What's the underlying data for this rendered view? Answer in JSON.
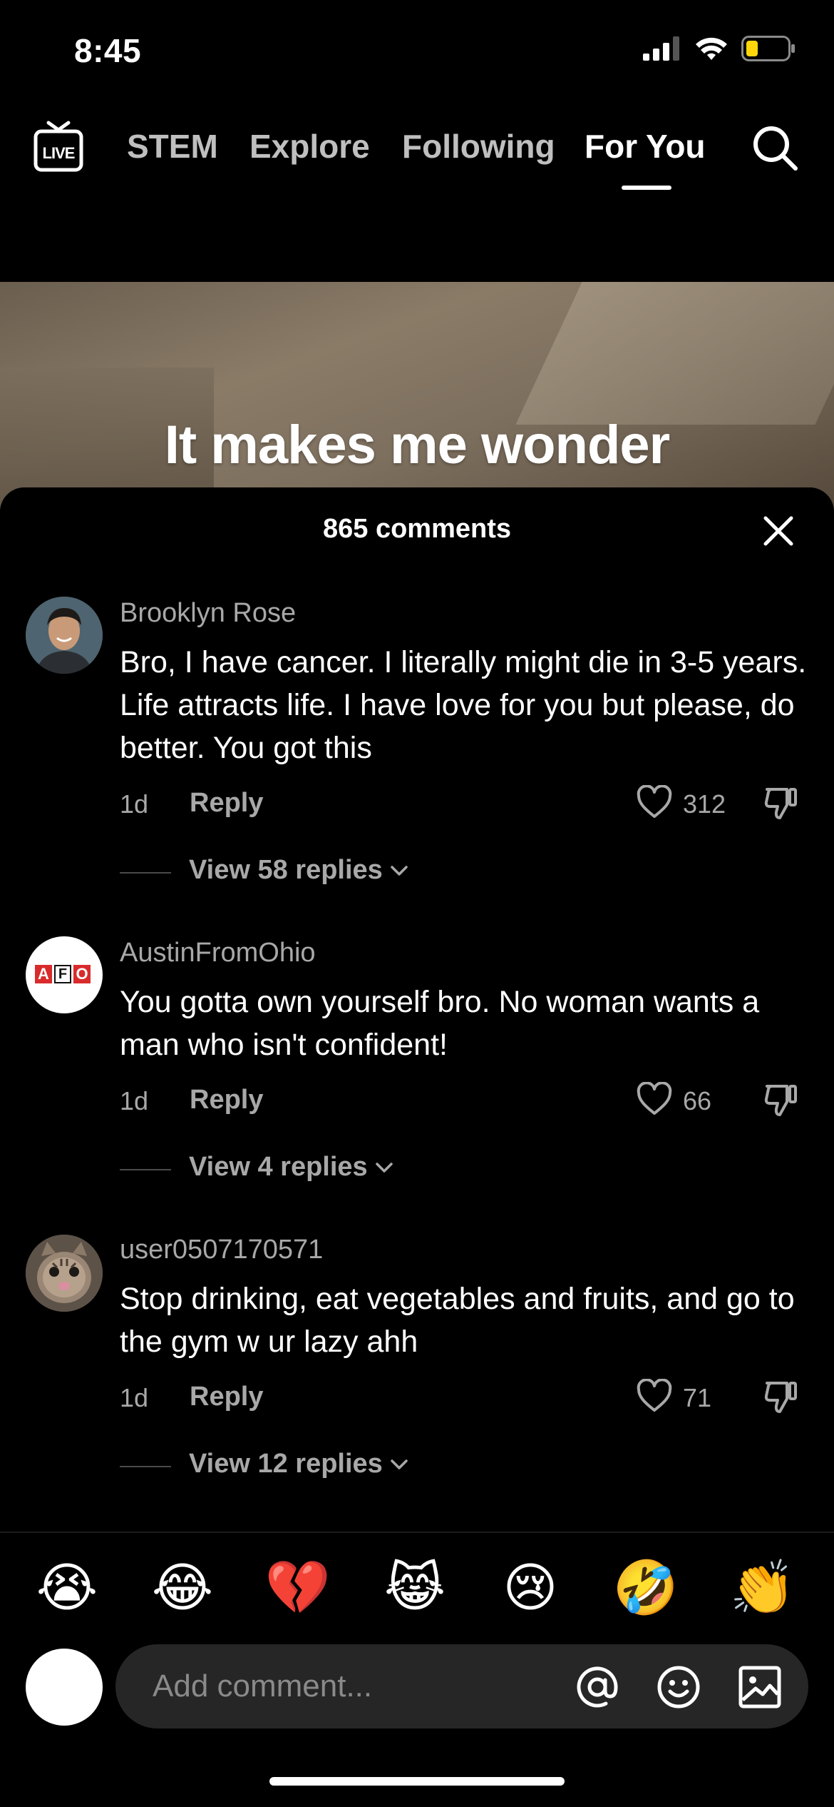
{
  "status_bar": {
    "time": "8:45"
  },
  "nav": {
    "live_label": "LIVE",
    "tabs": [
      {
        "label": "STEM"
      },
      {
        "label": "Explore"
      },
      {
        "label": "Following"
      },
      {
        "label": "For You",
        "active": true
      }
    ],
    "search_icon": "search-icon"
  },
  "video": {
    "caption": "It makes me wonder"
  },
  "comments_sheet": {
    "title": "865 comments",
    "comments": [
      {
        "username": "Brooklyn Rose",
        "text": "Bro, I have cancer. I literally might die in 3-5 years. Life attracts life. I have love for you but please, do better. You got this",
        "time": "1d",
        "reply_label": "Reply",
        "likes": "312",
        "view_replies": "View 58 replies"
      },
      {
        "username": "AustinFromOhio",
        "text": "You gotta own yourself bro. No woman wants a man who isn't confident!",
        "time": "1d",
        "reply_label": "Reply",
        "likes": "66",
        "view_replies": "View 4 replies",
        "avatar_letters": [
          "A",
          "F",
          "O"
        ]
      },
      {
        "username": "user0507170571",
        "text": "Stop drinking, eat vegetables and fruits, and go to the gym w ur lazy ahh",
        "time": "1d",
        "reply_label": "Reply",
        "likes": "71",
        "view_replies": "View 12 replies"
      }
    ]
  },
  "emoji_bar": [
    "😭",
    "😂",
    "💔",
    "😹",
    "😢",
    "🤣",
    "👏"
  ],
  "composer": {
    "placeholder": "Add comment..."
  },
  "colors": {
    "background": "#000000",
    "muted_text": "#a8a8a8",
    "input_bg": "#262626"
  }
}
